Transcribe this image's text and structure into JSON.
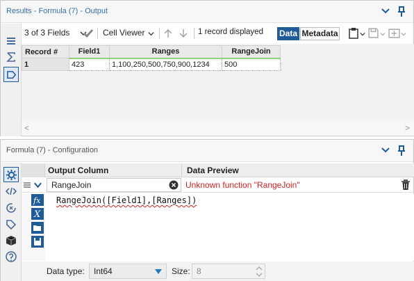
{
  "results": {
    "title": "Results - Formula (7) - Output",
    "toolbar": {
      "fields_label": "3 of 3 Fields",
      "viewer_label": "Cell Viewer",
      "records_label": "1 record displayed",
      "data_button": "Data",
      "metadata_button": "Metadata"
    },
    "table": {
      "headers": [
        "Record #",
        "Field1",
        "Ranges",
        "RangeJoin"
      ],
      "rows": [
        [
          "1",
          "423",
          "1,100,250,500,750,900,1234",
          "500"
        ]
      ]
    }
  },
  "config": {
    "title": "Formula (7) - Configuration",
    "grid_headers": {
      "output_column": "Output Column",
      "data_preview": "Data Preview"
    },
    "field": {
      "output_column": "RangeJoin",
      "data_preview": "Unknown function \"RangeJoin\""
    },
    "expression": "RangeJoin([Field1],[Ranges])",
    "bottom": {
      "data_type_label": "Data type:",
      "data_type_value": "Int64",
      "size_label": "Size:",
      "size_value": "8"
    }
  },
  "colors": {
    "title_blue": "#3a6ea8",
    "accent": "#1f5a99",
    "error_red": "#cc2222",
    "header_underline": "#8fd17b"
  }
}
